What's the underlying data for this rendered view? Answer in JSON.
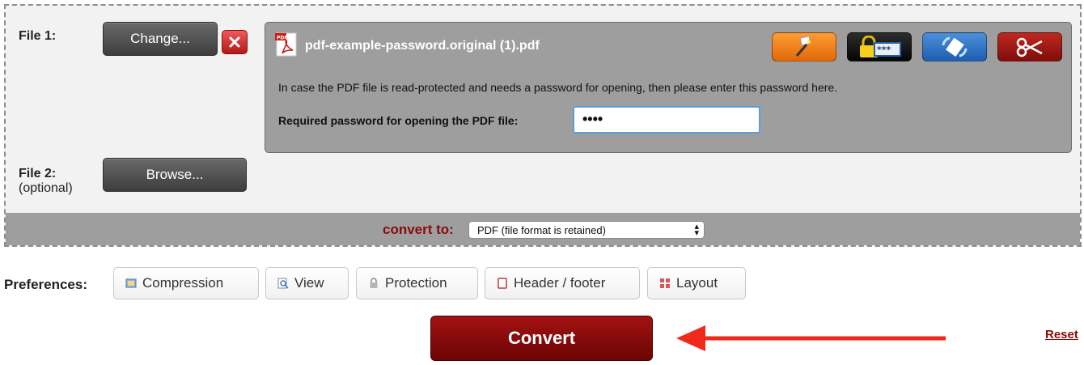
{
  "file1": {
    "label": "File 1:",
    "change_label": "Change...",
    "remove_icon": "close-icon",
    "file_name": "pdf-example-password.original (1).pdf",
    "info_text": "In case the PDF file is read-protected and needs a password for opening, then please enter this password here.",
    "password_label": "Required password for opening the PDF file:",
    "password_value": "••••",
    "tools": [
      "magic-wand-icon",
      "lock-password-icon",
      "rotate-icon",
      "scissors-icon"
    ]
  },
  "file2": {
    "label": "File 2:",
    "sublabel": "(optional)",
    "browse_label": "Browse..."
  },
  "convert": {
    "label": "convert to:",
    "format": "PDF (file format is retained)"
  },
  "preferences": {
    "label": "Preferences:",
    "items": [
      {
        "label": "Compression",
        "icon": "compression-icon"
      },
      {
        "label": "View",
        "icon": "view-icon"
      },
      {
        "label": "Protection",
        "icon": "lock-icon"
      },
      {
        "label": "Header / footer",
        "icon": "page-icon"
      },
      {
        "label": "Layout",
        "icon": "layout-icon"
      }
    ]
  },
  "actions": {
    "convert_label": "Convert",
    "reset_label": "Reset"
  },
  "colors": {
    "accent": "#8b0a0a",
    "arrow": "#f02a1a",
    "focus": "#5b9dd9"
  }
}
